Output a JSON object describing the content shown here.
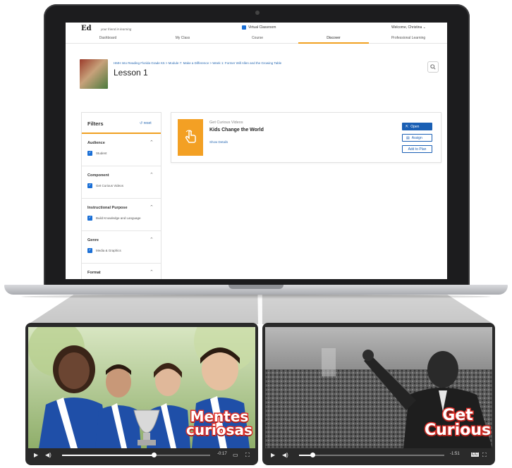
{
  "app": {
    "logo_text": "Ed",
    "logo_subtitle": "your friend in learning",
    "virtual_classroom": "Virtual Classroom",
    "welcome": "Welcome, Christina  ⌄"
  },
  "nav": {
    "items": [
      "Dashboard",
      "My Class",
      "Course",
      "Discover",
      "Professional Learning"
    ],
    "active": "Discover"
  },
  "lesson": {
    "breadcrumb": "HMH Into Reading Florida Grade K5  >  Module 7: Make a Difference  >  Week 1: Former Will Allen and the Growing Table",
    "title": "Lesson 1"
  },
  "filters": {
    "title": "Filters",
    "reset_label": "↺ reset",
    "sections": [
      {
        "title": "Audience",
        "option": "Student"
      },
      {
        "title": "Component",
        "option": "Get Curious Videos"
      },
      {
        "title": "Instructional Purpose",
        "option": "Build Knowledge and Language"
      },
      {
        "title": "Genre",
        "option": "Media & Graphics"
      },
      {
        "title": "Format",
        "option": ""
      }
    ]
  },
  "result": {
    "type": "Get Curious Videos",
    "title": "Kids Change the World",
    "details_link": "Show Details",
    "open_label": "Open",
    "assign_label": "Assign",
    "add_label": "Add to Plan"
  },
  "player_left": {
    "brand_line1": "Mentes",
    "brand_line2": "curiosas",
    "time": "-0:17",
    "progress": 0.62
  },
  "player_right": {
    "brand_line1": "Get",
    "brand_line2": "Curious",
    "time": "-1:51",
    "progress": 0.09
  },
  "colors": {
    "accent": "#f0a020",
    "primary": "#1a5fb4",
    "brand_red": "#e2312a"
  }
}
